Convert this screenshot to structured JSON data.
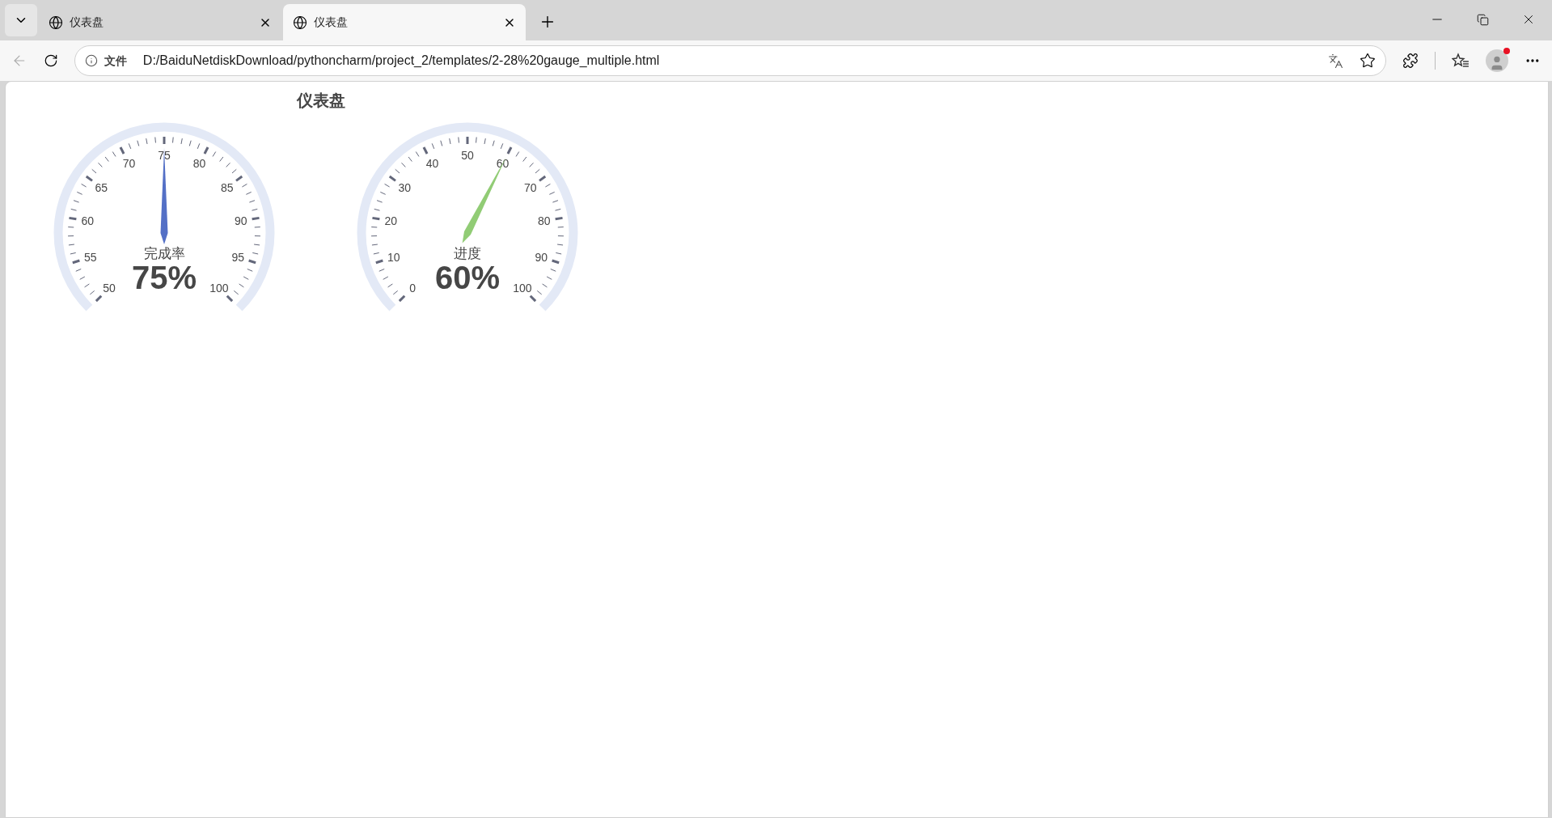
{
  "browser": {
    "tabs": [
      {
        "title": "仪表盘",
        "selected": false
      },
      {
        "title": "仪表盘",
        "selected": true
      }
    ],
    "address_bar": {
      "scheme_label": "文件",
      "url": "D:/BaiduNetdiskDownload/pythoncharm/project_2/templates/2-28%20gauge_multiple.html"
    },
    "profile": {
      "notification": true
    }
  },
  "page": {
    "title": "仪表盘",
    "gauges": [
      {
        "name": "完成率",
        "detail": "75%",
        "level": 0.5,
        "color": "#5470c6",
        "axis_labels": [
          "50",
          "55",
          "60",
          "65",
          "70",
          "75",
          "80",
          "85",
          "90",
          "95",
          "100"
        ]
      },
      {
        "name": "进度",
        "detail": "60%",
        "level": 0.6,
        "color": "#91cc75",
        "axis_labels": [
          "0",
          "10",
          "20",
          "30",
          "40",
          "50",
          "60",
          "70",
          "80",
          "90",
          "100"
        ]
      }
    ]
  }
}
